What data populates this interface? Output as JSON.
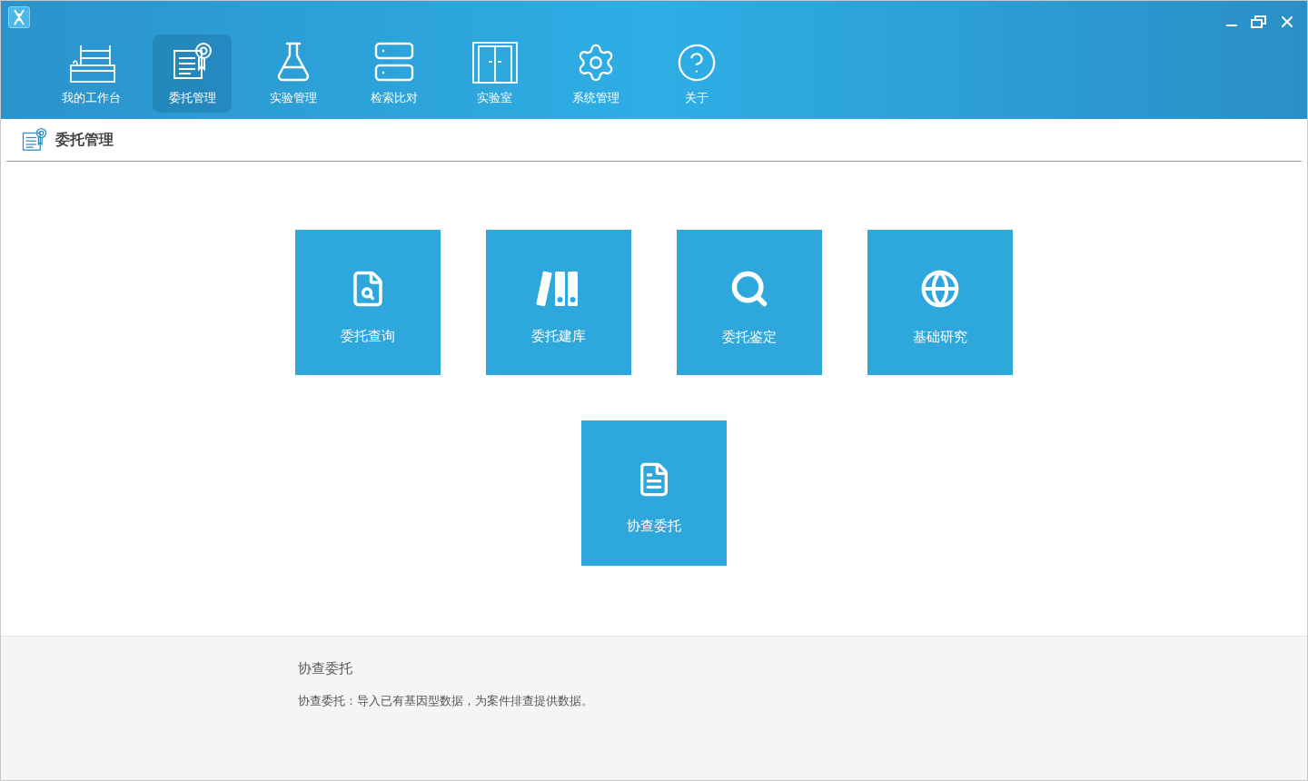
{
  "nav": [
    {
      "label": "我的工作台",
      "kind": "workbench",
      "selected": false
    },
    {
      "label": "委托管理",
      "kind": "certificate",
      "selected": true
    },
    {
      "label": "实验管理",
      "kind": "flask",
      "selected": false
    },
    {
      "label": "检索比对",
      "kind": "server",
      "selected": false
    },
    {
      "label": "实验室",
      "kind": "door",
      "selected": false
    },
    {
      "label": "系统管理",
      "kind": "gear",
      "selected": false
    },
    {
      "label": "关于",
      "kind": "help",
      "selected": false
    }
  ],
  "page_title": "委托管理",
  "tiles": [
    {
      "label": "委托查询",
      "kind": "file-search"
    },
    {
      "label": "委托建库",
      "kind": "binders"
    },
    {
      "label": "委托鉴定",
      "kind": "search"
    },
    {
      "label": "基础研究",
      "kind": "globe"
    },
    {
      "label": "协查委托",
      "kind": "document"
    }
  ],
  "info": {
    "title": "协查委托",
    "description": "协查委托：导入已有基因型数据，为案件排查提供数据。"
  }
}
